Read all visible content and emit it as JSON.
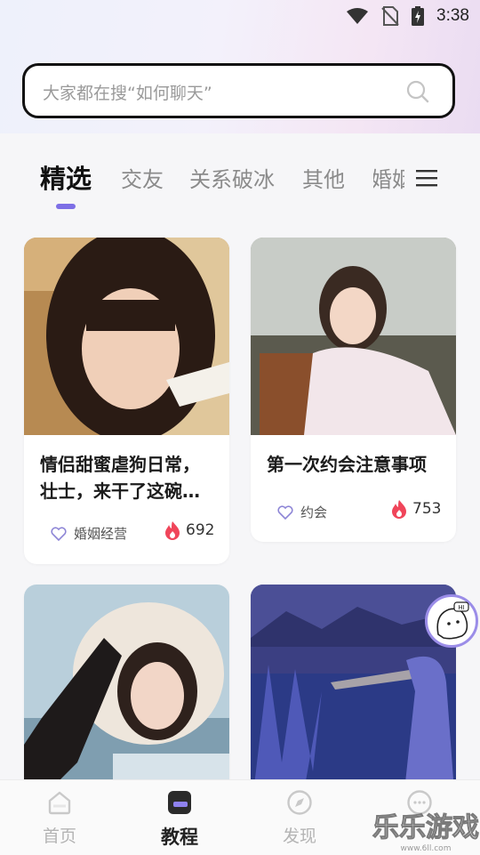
{
  "status_bar": {
    "time": "3:38",
    "icons": [
      "wifi-icon",
      "no-sim-icon",
      "battery-charging-icon"
    ]
  },
  "search": {
    "placeholder": "大家都在搜“如何聊天”",
    "icon": "search-icon"
  },
  "tabs": [
    {
      "label": "精选",
      "active": true
    },
    {
      "label": "交友",
      "active": false
    },
    {
      "label": "关系破冰",
      "active": false
    },
    {
      "label": "其他",
      "active": false
    },
    {
      "label": "婚姻",
      "active": false
    }
  ],
  "tabs_menu_icon": "menu-icon",
  "accent_color": "#7d6fe6",
  "cards": [
    {
      "title": "情侣甜蜜虐狗日常，壮士，来干了这碗…",
      "tag": "婚姻经营",
      "hot": "692"
    },
    {
      "title": "第一次约会注意事项",
      "tag": "约会",
      "hot": "753"
    },
    {
      "title": "",
      "tag": "",
      "hot": ""
    },
    {
      "title": "",
      "tag": "",
      "hot": ""
    }
  ],
  "floating_button": {
    "label": "HI"
  },
  "bottom_nav": [
    {
      "label": "首页",
      "icon": "home-icon",
      "active": false
    },
    {
      "label": "教程",
      "icon": "tutorial-icon",
      "active": true
    },
    {
      "label": "发现",
      "icon": "compass-icon",
      "active": false
    },
    {
      "label": "",
      "icon": "chat-bubble-icon",
      "active": false
    }
  ],
  "watermark": {
    "text": "乐乐游戏",
    "url_text": "www.6ll.com"
  }
}
